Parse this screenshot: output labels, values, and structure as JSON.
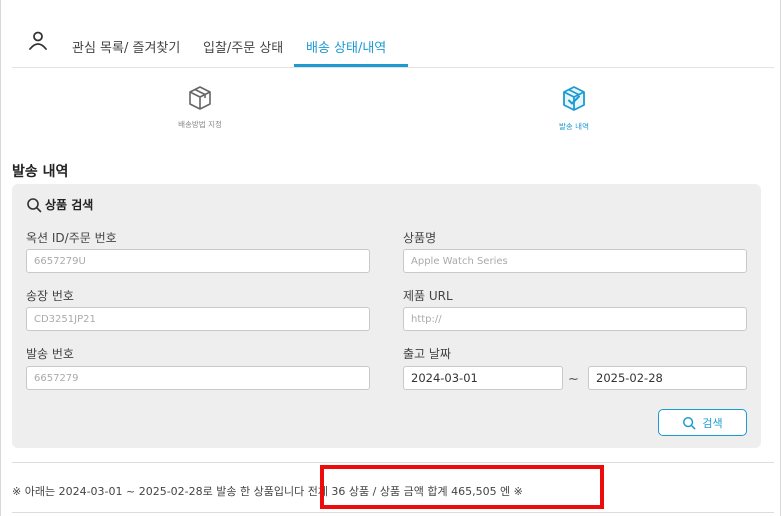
{
  "tabs": [
    {
      "label": "관심 목록/ 즐겨찾기",
      "active": false
    },
    {
      "label": "입찰/주문 상태",
      "active": false
    },
    {
      "label": "배송 상태/내역",
      "active": true
    }
  ],
  "subtabs": [
    {
      "label": "배송방법 지정",
      "icon": "box-icon",
      "active": false
    },
    {
      "label": "발송 내역",
      "icon": "box-check-icon",
      "active": true
    }
  ],
  "section_title": "발송 내역",
  "search_panel": {
    "title": "상품 검색",
    "auction_id_label": "옥션 ID/주문 번호",
    "auction_id_placeholder": "6657279U",
    "product_name_label": "상품명",
    "product_name_placeholder": "Apple Watch Series",
    "invoice_label": "송장 번호",
    "invoice_placeholder": "CD3251JP21",
    "product_url_label": "제품 URL",
    "product_url_placeholder": "http://",
    "shipment_label": "발송 번호",
    "shipment_placeholder": "6657279",
    "release_date_label": "출고 날짜",
    "date_from": "2024-03-01",
    "date_separator": "~",
    "date_to": "2025-02-28",
    "search_button": "검색"
  },
  "summary_text": "※ 아래는 2024-03-01 ~ 2025-02-28로 발송 한 상품입니다 전체 36 상품 / 상품 금액 합계 465,505 엔 ※",
  "colors": {
    "accent": "#1b9bd1",
    "highlight": "#ee0b0b",
    "panel_bg": "#eeeeee"
  }
}
